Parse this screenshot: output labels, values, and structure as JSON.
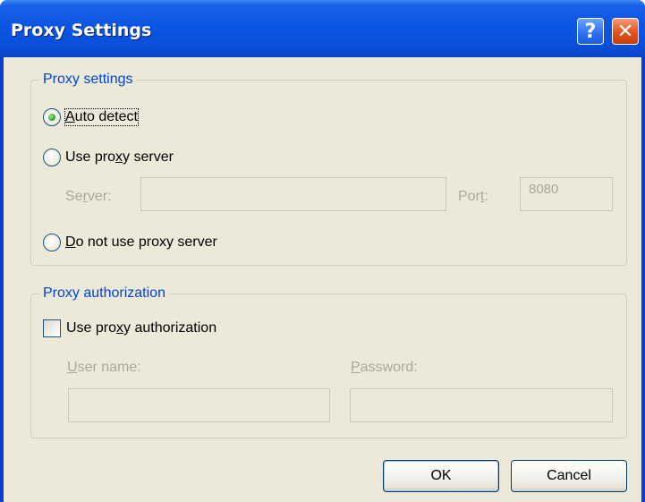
{
  "window": {
    "title": "Proxy Settings",
    "help_glyph": "?",
    "close_glyph": "✕"
  },
  "proxy_settings": {
    "group_title": "Proxy settings",
    "selected": "auto_detect",
    "options": {
      "auto_detect": {
        "before": "",
        "mnemonic": "A",
        "after": "uto detect"
      },
      "use_proxy_server": {
        "before": "Use pro",
        "mnemonic": "x",
        "after": "y server"
      },
      "no_proxy": {
        "before": "",
        "mnemonic": "D",
        "after": "o not use proxy server"
      }
    },
    "server_label": {
      "before": "Se",
      "mnemonic": "r",
      "after": "ver:"
    },
    "server_value": "",
    "port_label": {
      "before": "Por",
      "mnemonic": "t",
      "after": ":"
    },
    "port_value": "8080"
  },
  "proxy_authorization": {
    "group_title": "Proxy authorization",
    "checkbox": {
      "before": "Use pro",
      "mnemonic": "x",
      "after": "y authorization",
      "checked": false
    },
    "username_label": {
      "before": "",
      "mnemonic": "U",
      "after": "ser name:"
    },
    "username_value": "",
    "password_label": {
      "before": "",
      "mnemonic": "P",
      "after": "assword:"
    },
    "password_value": ""
  },
  "buttons": {
    "ok": "OK",
    "cancel": "Cancel"
  },
  "colors": {
    "titlebar": "#0a4fd9",
    "dialog_bg": "#ece9d8",
    "group_title": "#0046d5",
    "disabled_text": "#aca899"
  }
}
